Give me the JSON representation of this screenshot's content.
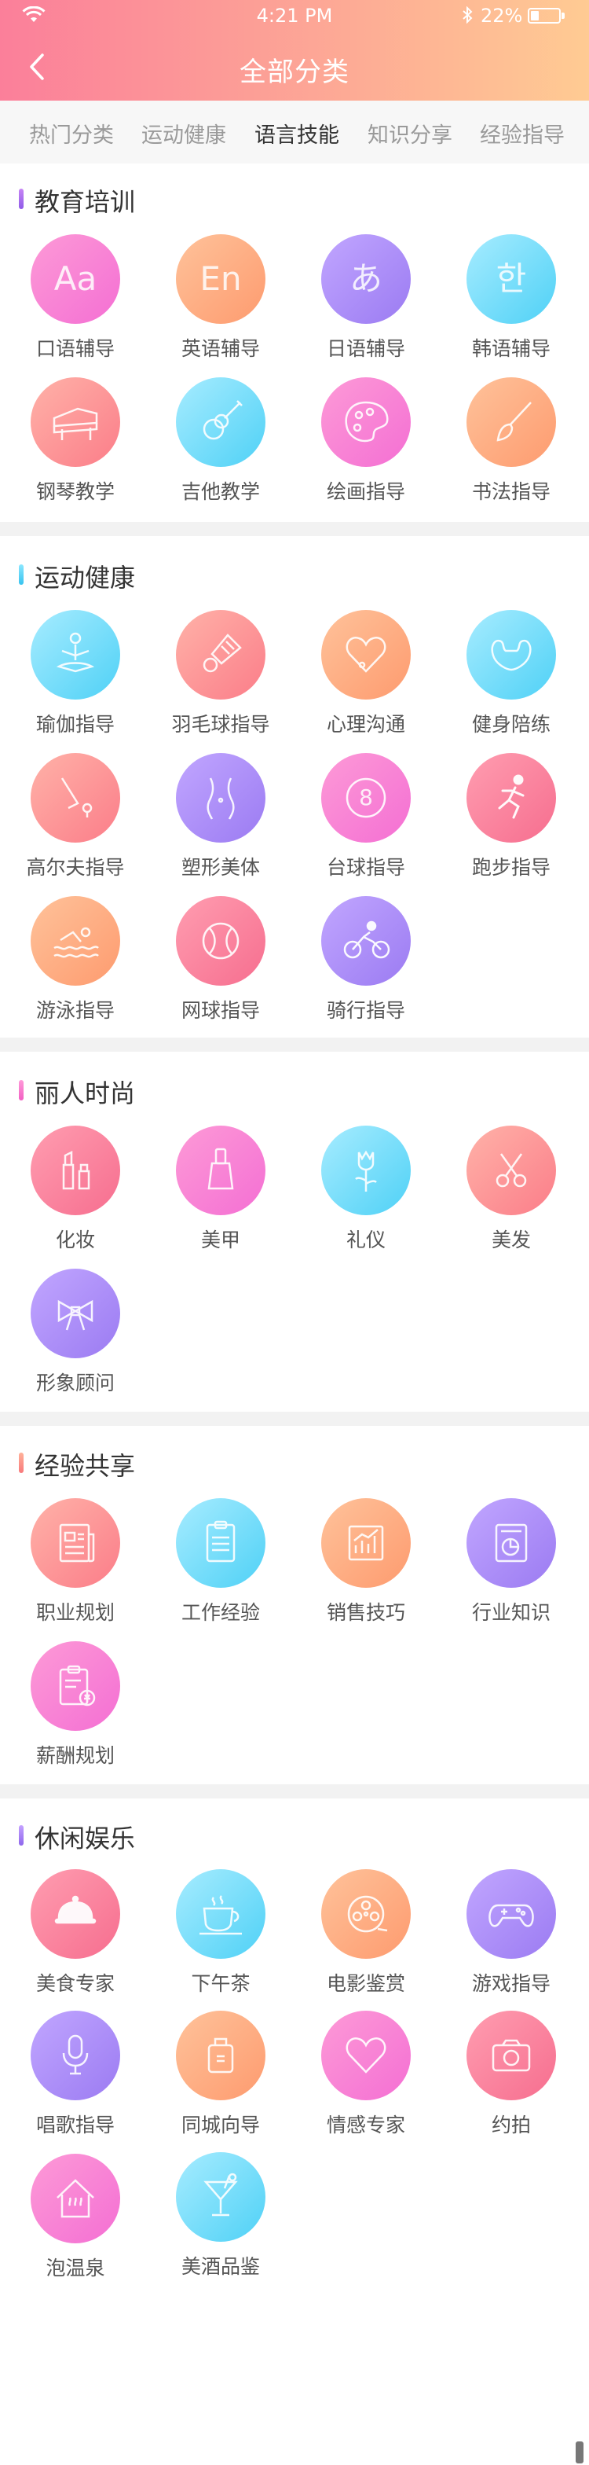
{
  "status_bar": {
    "time": "4:21 PM",
    "battery": "22%"
  },
  "header": {
    "title": "全部分类"
  },
  "tabs": [
    {
      "label": "热门分类",
      "active": false
    },
    {
      "label": "运动健康",
      "active": false
    },
    {
      "label": "语言技能",
      "active": true
    },
    {
      "label": "知识分享",
      "active": false
    },
    {
      "label": "经验指导",
      "active": false
    }
  ],
  "sections": [
    {
      "title": "教育培训",
      "items": [
        {
          "label": "口语辅导",
          "glyph": "Aa",
          "icon": "text-aa-icon"
        },
        {
          "label": "英语辅导",
          "glyph": "En",
          "icon": "english-icon"
        },
        {
          "label": "日语辅导",
          "glyph": "あ",
          "icon": "japanese-icon"
        },
        {
          "label": "韩语辅导",
          "glyph": "한",
          "icon": "korean-icon"
        },
        {
          "label": "钢琴教学",
          "icon": "piano-icon"
        },
        {
          "label": "吉他教学",
          "icon": "guitar-icon"
        },
        {
          "label": "绘画指导",
          "icon": "palette-icon"
        },
        {
          "label": "书法指导",
          "icon": "brush-icon"
        }
      ]
    },
    {
      "title": "运动健康",
      "items": [
        {
          "label": "瑜伽指导",
          "icon": "yoga-icon"
        },
        {
          "label": "羽毛球指导",
          "icon": "shuttlecock-icon"
        },
        {
          "label": "心理沟通",
          "icon": "heart-icon"
        },
        {
          "label": "健身陪练",
          "icon": "muscle-icon"
        },
        {
          "label": "高尔夫指导",
          "icon": "golf-icon"
        },
        {
          "label": "塑形美体",
          "icon": "body-shape-icon"
        },
        {
          "label": "台球指导",
          "glyph": "8",
          "icon": "billiard-ball-icon"
        },
        {
          "label": "跑步指导",
          "icon": "running-icon"
        },
        {
          "label": "游泳指导",
          "icon": "swimming-icon"
        },
        {
          "label": "网球指导",
          "icon": "ball-icon"
        },
        {
          "label": "骑行指导",
          "icon": "cycling-icon"
        }
      ]
    },
    {
      "title": "丽人时尚",
      "items": [
        {
          "label": "化妆",
          "icon": "makeup-icon"
        },
        {
          "label": "美甲",
          "icon": "nail-polish-icon"
        },
        {
          "label": "礼仪",
          "icon": "rose-icon"
        },
        {
          "label": "美发",
          "icon": "scissors-icon"
        },
        {
          "label": "形象顾问",
          "icon": "bow-icon"
        }
      ]
    },
    {
      "title": "经验共享",
      "items": [
        {
          "label": "职业规划",
          "icon": "newspaper-icon"
        },
        {
          "label": "工作经验",
          "icon": "clipboard-icon"
        },
        {
          "label": "销售技巧",
          "icon": "chart-icon"
        },
        {
          "label": "行业知识",
          "icon": "report-icon"
        },
        {
          "label": "薪酬规划",
          "icon": "salary-icon"
        }
      ]
    },
    {
      "title": "休闲娱乐",
      "items": [
        {
          "label": "美食专家",
          "icon": "cloche-icon"
        },
        {
          "label": "下午茶",
          "icon": "tea-cup-icon"
        },
        {
          "label": "电影鉴赏",
          "icon": "film-reel-icon"
        },
        {
          "label": "游戏指导",
          "icon": "gamepad-icon"
        },
        {
          "label": "唱歌指导",
          "icon": "microphone-icon"
        },
        {
          "label": "同城向导",
          "icon": "luggage-icon"
        },
        {
          "label": "情感专家",
          "icon": "heart-icon"
        },
        {
          "label": "约拍",
          "icon": "camera-icon"
        },
        {
          "label": "泡温泉",
          "icon": "hot-spring-icon"
        },
        {
          "label": "美酒品鉴",
          "icon": "cocktail-icon"
        }
      ]
    }
  ],
  "colors": {
    "header_gradient": [
      "#fb7f9a",
      "#ffcb93"
    ],
    "tab_active": "#333333",
    "tab_inactive": "#9a9a9a",
    "section_bars": [
      "#b36cf0",
      "#49cdf2",
      "#f76fc6",
      "#fd8d7a",
      "#a68bf2"
    ]
  }
}
